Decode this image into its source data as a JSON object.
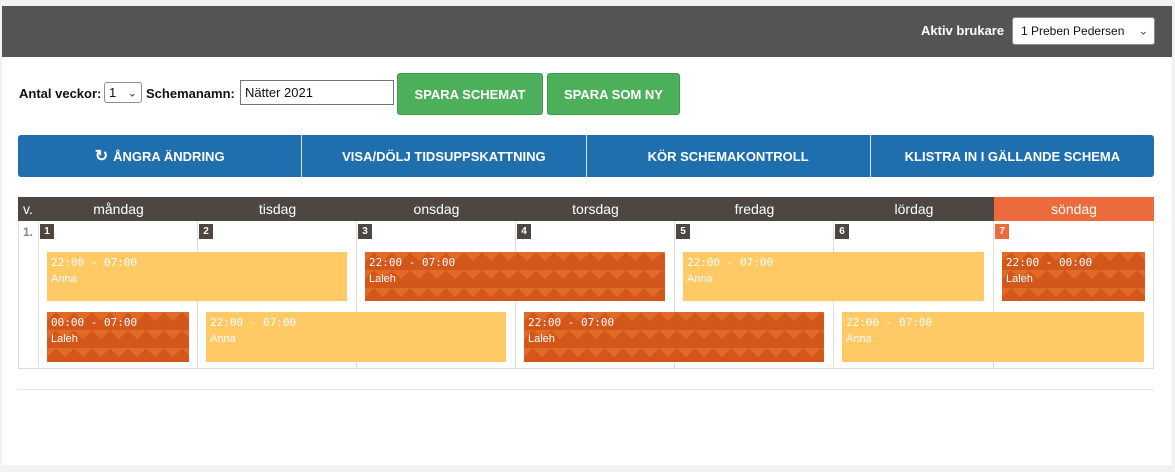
{
  "header": {
    "active_user_label": "Aktiv brukare",
    "active_user_value": "1 Preben Pedersen"
  },
  "settings": {
    "weeks_label": "Antal veckor:",
    "weeks_value": "1",
    "schedule_name_label": "Schemanamn:",
    "schedule_name_value": "Nätter 2021",
    "save_label": "SPARA SCHEMAT",
    "save_as_new_label": "SPARA SOM NY"
  },
  "actions": {
    "undo": "ÅNGRA ÄNDRING",
    "toggle_estimate": "VISA/DÖLJ TIDSUPPSKATTNING",
    "run_check": "KÖR SCHEMAKONTROLL",
    "paste": "KLISTRA IN I GÄLLANDE SCHEMA"
  },
  "calendar": {
    "week_col_label": "v.",
    "week_label": "1.",
    "days": [
      {
        "name": "måndag",
        "num": "1"
      },
      {
        "name": "tisdag",
        "num": "2"
      },
      {
        "name": "onsdag",
        "num": "3"
      },
      {
        "name": "torsdag",
        "num": "4"
      },
      {
        "name": "fredag",
        "num": "5"
      },
      {
        "name": "lördag",
        "num": "6"
      },
      {
        "name": "söndag",
        "num": "7"
      }
    ],
    "shifts": [
      {
        "time": "22:00 - 07:00",
        "person": "Anna",
        "color": "yellow"
      },
      {
        "time": "22:00 - 07:00",
        "person": "Laleh",
        "color": "orange"
      },
      {
        "time": "22:00 - 07:00",
        "person": "Anna",
        "color": "yellow"
      },
      {
        "time": "22:00 - 00:00",
        "person": "Laleh",
        "color": "orange"
      },
      {
        "time": "00:00 - 07:00",
        "person": "Laleh",
        "color": "orange"
      },
      {
        "time": "22:00 - 07:00",
        "person": "Anna",
        "color": "yellow"
      },
      {
        "time": "22:00 - 07:00",
        "person": "Laleh",
        "color": "orange"
      },
      {
        "time": "22:00 - 07:00",
        "person": "Anna",
        "color": "yellow"
      }
    ]
  },
  "colors": {
    "topbar": "#545454",
    "green_button": "#4cb05a",
    "blue_button": "#1f6faf",
    "header_dark": "#4e4641",
    "sunday": "#ec6b3c",
    "shift_yellow": "#ffc966",
    "shift_orange": "#d3561a"
  }
}
